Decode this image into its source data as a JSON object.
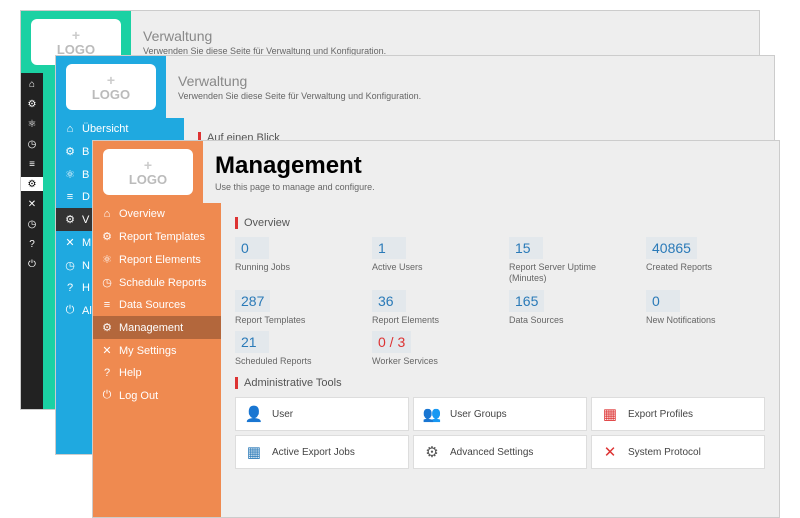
{
  "logo_label": "LOGO",
  "win1": {
    "title": "Verwaltung",
    "subtitle": "Verwenden Sie diese Seite für Verwaltung und Konfiguration."
  },
  "win2": {
    "title": "Verwaltung",
    "subtitle": "Verwenden Sie diese Seite für Verwaltung und Konfiguration.",
    "section": "Auf einen Blick",
    "side": [
      "Übersicht",
      "B",
      "B",
      "D",
      "V",
      "M",
      "N",
      "H",
      "Al"
    ]
  },
  "win3": {
    "title": "Management",
    "subtitle": "Use this page to manage and configure.",
    "side": [
      "Overview",
      "Report Templates",
      "Report Elements",
      "Schedule Reports",
      "Data Sources",
      "Management",
      "My Settings",
      "Help",
      "Log Out"
    ],
    "overview_label": "Overview",
    "stats": [
      {
        "v": "0",
        "l": "Running Jobs"
      },
      {
        "v": "1",
        "l": "Active Users"
      },
      {
        "v": "15",
        "l": "Report Server Uptime (Minutes)"
      },
      {
        "v": "40865",
        "l": "Created Reports"
      },
      {
        "v": "287",
        "l": "Report Templates"
      },
      {
        "v": "36",
        "l": "Report Elements"
      },
      {
        "v": "165",
        "l": "Data Sources"
      },
      {
        "v": "0",
        "l": "New Notifications"
      },
      {
        "v": "21",
        "l": "Scheduled Reports"
      },
      {
        "v": "0 / 3",
        "l": "Worker Services",
        "red": true
      }
    ],
    "admin_label": "Administrative Tools",
    "tools": [
      "User",
      "User Groups",
      "Export Profiles",
      "Active Export Jobs",
      "Advanced Settings",
      "System Protocol"
    ]
  }
}
